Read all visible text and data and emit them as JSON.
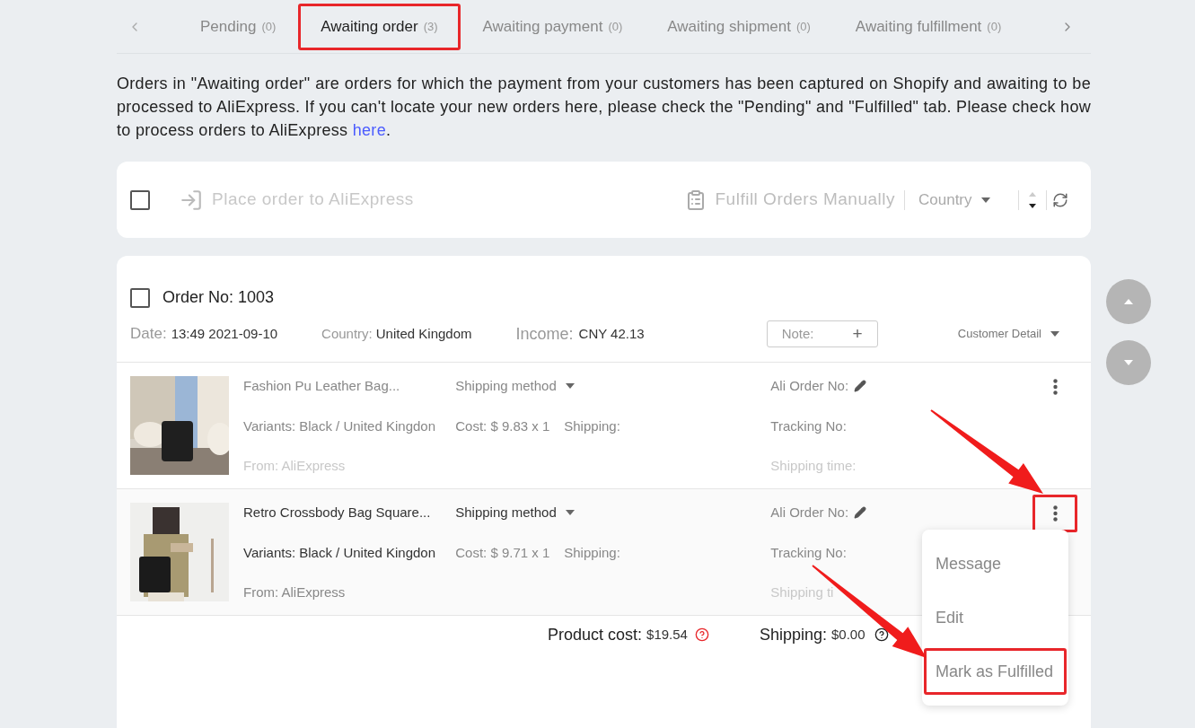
{
  "tabs": [
    {
      "label": "Pending",
      "count": "(0)",
      "selected": false,
      "annotated": false
    },
    {
      "label": "Awaiting order",
      "count": "(3)",
      "selected": true,
      "annotated": true
    },
    {
      "label": "Awaiting payment",
      "count": "(0)",
      "selected": false,
      "annotated": false
    },
    {
      "label": "Awaiting shipment",
      "count": "(0)",
      "selected": false,
      "annotated": false
    },
    {
      "label": "Awaiting fulfillment",
      "count": "(0)",
      "selected": false,
      "annotated": false
    }
  ],
  "description": {
    "text": "Orders in \"Awaiting order\" are orders for which the payment from your customers has been captured on Shopify and awaiting to be processed to AliExpress. If you can't locate your new orders here, please check the \"Pending\" and \"Fulfilled\" tab. Please check how to process orders to AliExpress",
    "link": "here",
    "after": "."
  },
  "toolbar": {
    "checked": false,
    "place_order": "Place order to AliExpress",
    "fulfill": "Fulfill Orders Manually",
    "country": "Country"
  },
  "order": {
    "checked": false,
    "number": "Order No: 1003",
    "date_label": "Date:",
    "date": "13:49 2021-09-10",
    "country_label": "Country:",
    "country": "United Kingdom",
    "income_label": "Income:",
    "income": "CNY 42.13",
    "note_label": "Note:",
    "note_add": "+",
    "customer_detail": "Customer Detail",
    "items": [
      {
        "title": "Fashion Pu Leather Bag...",
        "variants": "Variants: Black / United Kingdon",
        "from": "From: AliExpress",
        "shipping_method": "Shipping method",
        "cost": "Cost: $ 9.83 x 1",
        "shipping": "Shipping:",
        "ali_order": "Ali Order No:",
        "tracking": "Tracking No:",
        "shipping_time": "Shipping time:",
        "hovered": false,
        "annotated": false
      },
      {
        "title": "Retro Crossbody Bag Square...",
        "variants": "Variants: Black / United Kingdon",
        "from": "From: AliExpress",
        "shipping_method": "Shipping method",
        "cost": "Cost: $ 9.71 x 1",
        "shipping": "Shipping:",
        "ali_order": "Ali Order No:",
        "tracking": "Tracking No:",
        "shipping_time": "Shipping ti",
        "hovered": true,
        "annotated": true
      }
    ],
    "product_cost_label": "Product cost:",
    "product_cost": "$19.54",
    "shipping_label": "Shipping:",
    "shipping": "$0.00"
  },
  "menu": [
    {
      "label": "Message",
      "annotated": false
    },
    {
      "label": "Edit",
      "annotated": false
    },
    {
      "label": "Mark as Fulfilled",
      "annotated": true
    }
  ]
}
